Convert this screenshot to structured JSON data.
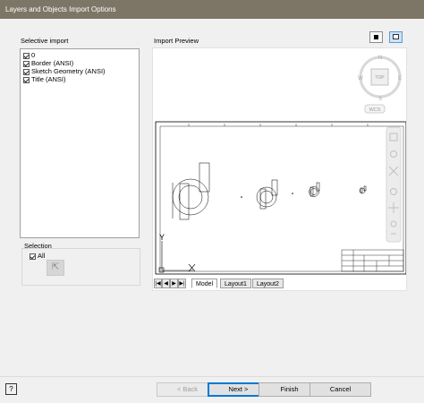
{
  "window": {
    "title": "Layers and Objects Import Options"
  },
  "left": {
    "selective_import_label": "Selective import",
    "layers": [
      {
        "label": "0",
        "checked": true
      },
      {
        "label": "Border (ANSI)",
        "checked": true
      },
      {
        "label": "Sketch Geometry (ANSI)",
        "checked": true
      },
      {
        "label": "Title (ANSI)",
        "checked": true
      }
    ],
    "selection_label": "Selection",
    "all_label": "All",
    "all_checked": true
  },
  "preview": {
    "label": "Import Preview",
    "viewcube": {
      "top": "TOP",
      "north": "N",
      "south": "S",
      "east": "E",
      "west": "W",
      "wcs": "WCS"
    },
    "axis_y": "Y",
    "tabs": [
      "Model",
      "Layout1",
      "Layout2"
    ],
    "active_tab": "Model"
  },
  "buttons": {
    "back": "< Back",
    "next": "Next >",
    "finish": "Finish",
    "cancel": "Cancel"
  },
  "colors": {
    "titlebar": "#7d7565",
    "default_button_border": "#0078d7"
  }
}
